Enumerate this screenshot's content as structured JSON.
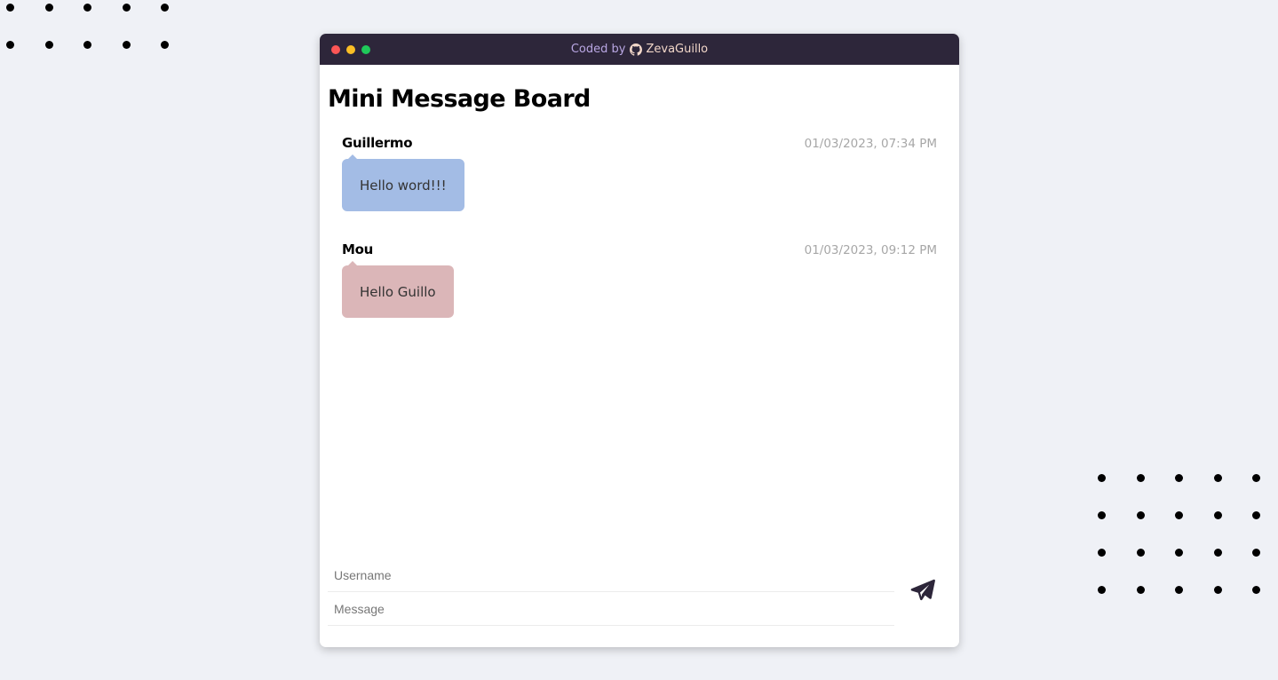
{
  "colors": {
    "titlebar": "#2d263a",
    "dot_red": "#fd5656",
    "dot_yellow": "#fbbf25",
    "dot_green": "#1fc95a",
    "bubble_blue": "#a3bce5",
    "bubble_pink": "#dbb6b8",
    "send_icon": "#2d263a"
  },
  "titlebar": {
    "credit_prefix": "Coded by",
    "author": "ZevaGuillo",
    "author_icon": "github-icon"
  },
  "page_title": "Mini Message Board",
  "messages": [
    {
      "user": "Guillermo",
      "time": "01/03/2023, 07:34 PM",
      "text": "Hello word!!!",
      "color": "#a3bce5"
    },
    {
      "user": "Mou",
      "time": "01/03/2023, 09:12 PM",
      "text": "Hello Guillo",
      "color": "#dbb6b8"
    }
  ],
  "form": {
    "username_placeholder": "Username",
    "message_placeholder": "Message",
    "send_icon": "paper-plane-icon"
  }
}
